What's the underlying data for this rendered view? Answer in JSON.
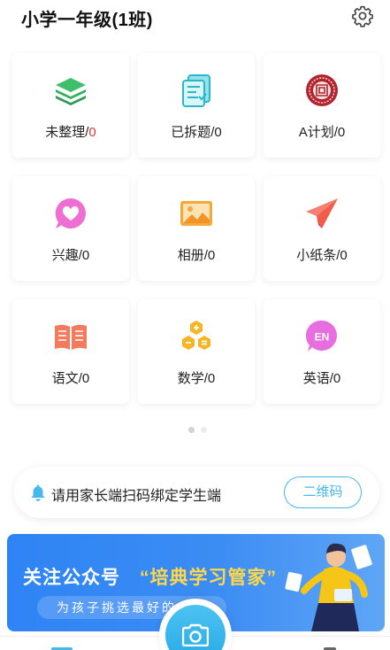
{
  "header": {
    "title": "小学一年级(1班)",
    "settings_icon": "gear-icon"
  },
  "tiles": [
    {
      "name": "未整理",
      "sep": "/",
      "count": "0",
      "count_red": true,
      "icon": "stack-layers-icon"
    },
    {
      "name": "已拆题",
      "sep": "/",
      "count": "0",
      "count_red": false,
      "icon": "document-split-icon"
    },
    {
      "name": "A计划",
      "sep": "/",
      "count": "0",
      "count_red": false,
      "icon": "seal-badge-icon"
    },
    {
      "name": "兴趣",
      "sep": "/",
      "count": "0",
      "count_red": false,
      "icon": "heart-bubble-icon"
    },
    {
      "name": "相册",
      "sep": "/",
      "count": "0",
      "count_red": false,
      "icon": "photo-album-icon"
    },
    {
      "name": "小纸条",
      "sep": "/",
      "count": "0",
      "count_red": false,
      "icon": "paper-plane-icon"
    },
    {
      "name": "语文",
      "sep": "/",
      "count": "0",
      "count_red": false,
      "icon": "open-book-icon"
    },
    {
      "name": "数学",
      "sep": "/",
      "count": "0",
      "count_red": false,
      "icon": "math-hexagons-icon"
    },
    {
      "name": "英语",
      "sep": "/",
      "count": "0",
      "count_red": false,
      "icon": "en-circle-icon"
    }
  ],
  "icon_text": {
    "en": "EN"
  },
  "pager": {
    "pages": 2,
    "active": 1
  },
  "bind": {
    "text": "请用家长端扫码绑定学生端",
    "button": "二维码",
    "icon": "bell-icon"
  },
  "banner": {
    "title_prefix": "关注公众号",
    "title_highlight": "“培典学习管家”",
    "subtitle": "为孩子挑选最好的老师"
  },
  "camera": {
    "icon": "camera-icon"
  },
  "colors": {
    "accent": "#46b8ea",
    "red_count": "#e03b32",
    "banner_blue": "#2f84f5",
    "banner_yellow": "#ffd84a"
  }
}
